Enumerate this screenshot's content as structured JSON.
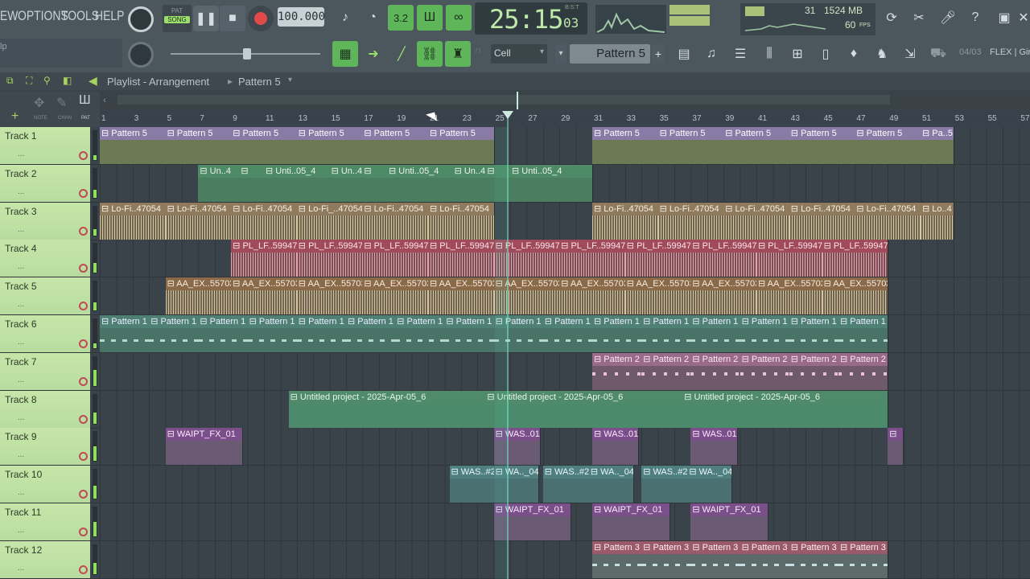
{
  "menu": [
    "EW",
    "OPTIONS",
    "TOOLS",
    "HELP"
  ],
  "transport": {
    "pat": "PAT",
    "song": "SONG",
    "tempo": "100.000",
    "time": "25:15",
    "time_sub": "03",
    "bst": "B:S:T"
  },
  "monitor": {
    "cpu": "31",
    "mem": "1524 MB",
    "poly": "60",
    "fps": "FPS"
  },
  "toolbar2": {
    "snap": "Cell",
    "pattern": "Pattern 5",
    "hint_left": "lp",
    "news": "04/03",
    "news_text": "FLEX | Gir"
  },
  "playlist": {
    "title": "Playlist - Arrangement",
    "pattern": "Pattern 5"
  },
  "side_tabs": [
    "NOTE",
    "CHAN",
    "PAT"
  ],
  "ruler": [
    "1",
    "3",
    "5",
    "7",
    "9",
    "11",
    "13",
    "15",
    "17",
    "19",
    "21",
    "23",
    "25",
    "27",
    "29",
    "31",
    "33",
    "35",
    "37",
    "39",
    "41",
    "43",
    "45",
    "47",
    "49",
    "51",
    "53",
    "55",
    "57"
  ],
  "tracks": [
    {
      "name": "Track 1",
      "clips": [
        {
          "label": "Pattern 5"
        },
        {
          "label": "Pattern 5"
        },
        {
          "label": "Pattern 5"
        },
        {
          "label": "Pattern 5"
        },
        {
          "label": "Pattern 5"
        },
        {
          "label": "Pattern 5"
        },
        {
          "label": "Pattern 5"
        },
        {
          "label": "Pattern 5"
        },
        {
          "label": "Pattern 5"
        },
        {
          "label": "Pattern 5"
        },
        {
          "label": "Pattern 5"
        },
        {
          "label": "Pa..5"
        }
      ]
    },
    {
      "name": "Track 2",
      "clips": [
        {
          "label": "Un..4"
        },
        {
          "label": ""
        },
        {
          "label": "Unti..05_4"
        },
        {
          "label": "Un..4"
        },
        {
          "label": ""
        },
        {
          "label": "Unti..05_4"
        },
        {
          "label": "Un..4"
        },
        {
          "label": ""
        },
        {
          "label": "Unti..05_4"
        }
      ]
    },
    {
      "name": "Track 3",
      "clips": [
        {
          "label": "Lo-Fi..47054"
        },
        {
          "label": "Lo-Fi..47054"
        },
        {
          "label": "Lo-Fi..47054"
        },
        {
          "label": "Lo-Fi_..47054"
        },
        {
          "label": "Lo-Fi..47054"
        },
        {
          "label": "Lo-Fi..47054"
        },
        {
          "label": "Lo-Fi..47054"
        },
        {
          "label": "Lo-Fi..47054"
        },
        {
          "label": "Lo-Fi..47054"
        },
        {
          "label": "Lo-Fi..47054"
        },
        {
          "label": "Lo-Fi..47054"
        },
        {
          "label": "Lo..4"
        }
      ]
    },
    {
      "name": "Track 4",
      "clips": [
        {
          "label": "PL_LF..59947"
        },
        {
          "label": "PL_LF..59947"
        },
        {
          "label": "PL_LF..59947"
        },
        {
          "label": "PL_LF..59947"
        },
        {
          "label": "PL_LF..59947"
        },
        {
          "label": "PL_LF..59947"
        },
        {
          "label": "PL_LF..59947"
        },
        {
          "label": "PL_LF..59947"
        },
        {
          "label": "PL_LF..59947"
        },
        {
          "label": "PL_LF..59947"
        }
      ]
    },
    {
      "name": "Track 5",
      "clips": [
        {
          "label": "AA_EX..55703"
        },
        {
          "label": "AA_EX..55703"
        },
        {
          "label": "AA_EX..55703"
        },
        {
          "label": "AA_EX..55703"
        },
        {
          "label": "AA_EX..55703"
        },
        {
          "label": "AA_EX..55703"
        },
        {
          "label": "AA_EX..55703"
        },
        {
          "label": "AA_EX..55703"
        },
        {
          "label": "AA_EX..55703"
        },
        {
          "label": "AA_EX..55703"
        },
        {
          "label": "AA_EX..55703"
        }
      ]
    },
    {
      "name": "Track 6",
      "clips": [
        {
          "label": "Pattern 1"
        },
        {
          "label": "Pattern 1"
        },
        {
          "label": "Pattern 1"
        },
        {
          "label": "Pattern 1"
        },
        {
          "label": "Pattern 1"
        },
        {
          "label": "Pattern 1"
        },
        {
          "label": "Pattern 1"
        },
        {
          "label": "Pattern 1"
        },
        {
          "label": "Pattern 1"
        },
        {
          "label": "Pattern 1"
        },
        {
          "label": "Pattern 1"
        },
        {
          "label": "Pattern 1"
        },
        {
          "label": "Pattern 1"
        },
        {
          "label": "Pattern 1"
        },
        {
          "label": "Pattern 1"
        },
        {
          "label": "Pattern 1"
        }
      ]
    },
    {
      "name": "Track 7",
      "clips": [
        {
          "label": "Pattern 2"
        },
        {
          "label": "Pattern 2"
        },
        {
          "label": "Pattern 2"
        },
        {
          "label": "Pattern 2"
        },
        {
          "label": "Pattern 2"
        },
        {
          "label": "Pattern 2"
        }
      ]
    },
    {
      "name": "Track 8",
      "clips": [
        {
          "label": "Untitled project - 2025-Apr-05_6"
        },
        {
          "label": "Untitled project - 2025-Apr-05_6"
        },
        {
          "label": "Untitled project - 2025-Apr-05_6"
        }
      ]
    },
    {
      "name": "Track 9",
      "clips": [
        {
          "label": "WAIPT_FX_01"
        },
        {
          "label": "WAS..01"
        },
        {
          "label": "WAS..01"
        },
        {
          "label": "WAS..01"
        },
        {
          "label": ""
        }
      ]
    },
    {
      "name": "Track 10",
      "clips": [
        {
          "label": "WAS..#2"
        },
        {
          "label": "WA.._04"
        },
        {
          "label": "WAS..#2"
        },
        {
          "label": "WA.._04"
        },
        {
          "label": "WAS..#2"
        },
        {
          "label": "WA.._04"
        }
      ]
    },
    {
      "name": "Track 11",
      "clips": [
        {
          "label": "WAIPT_FX_01"
        },
        {
          "label": "WAIPT_FX_01"
        },
        {
          "label": "WAIPT_FX_01"
        }
      ]
    },
    {
      "name": "Track 12",
      "clips": [
        {
          "label": "Pattern 3"
        },
        {
          "label": "Pattern 3"
        },
        {
          "label": "Pattern 3"
        },
        {
          "label": "Pattern 3"
        },
        {
          "label": "Pattern 3"
        },
        {
          "label": "Pattern 3"
        }
      ]
    }
  ]
}
